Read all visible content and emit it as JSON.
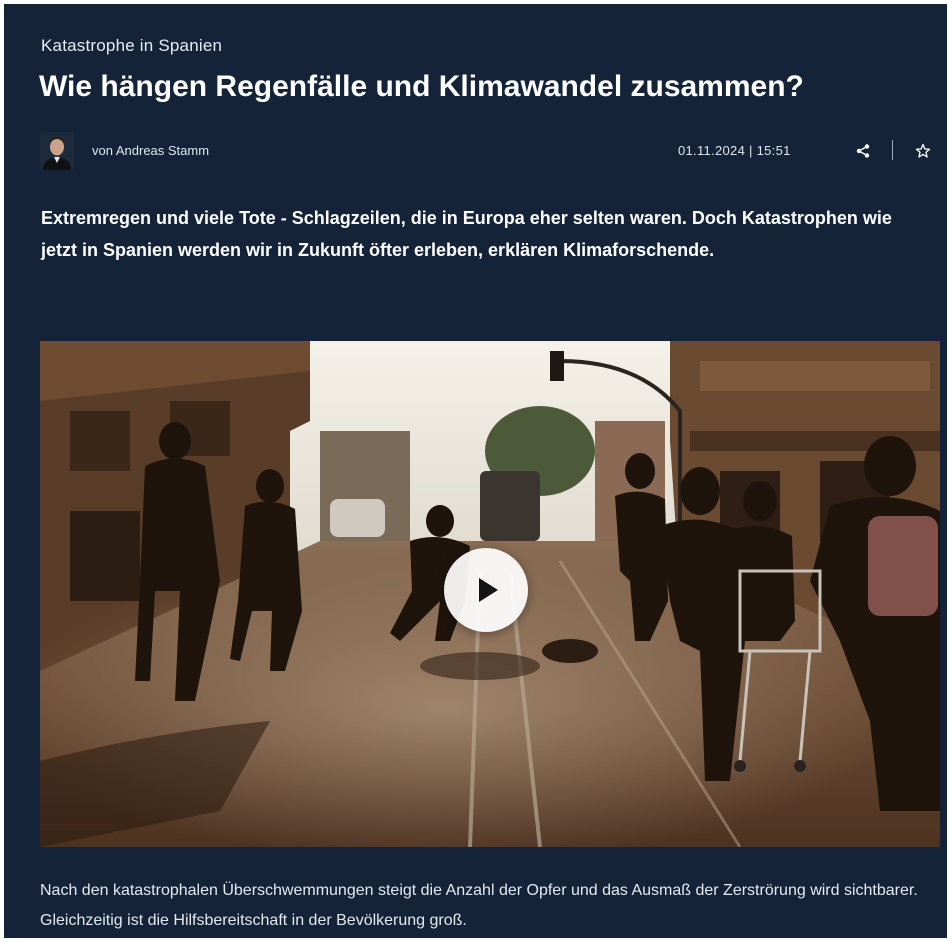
{
  "article": {
    "kicker": "Katastrophe in Spanien",
    "headline": "Wie hängen Regenfälle und Klimawandel zusammen?",
    "author": "von Andreas Stamm",
    "date": "01.11.2024 | 15:51",
    "teaser": "Extremregen und viele Tote - Schlagzeilen, die in Europa eher selten waren. Doch Katastrophen wie jetzt in Spanien werden wir in Zukunft öfter erleben, erklären Klimaforschende.",
    "caption": "Nach den katastrophalen Überschwemmungen steigt die Anzahl der Opfer und das Ausmaß der Zerströrung wird sichtbarer. Gleichzeitig ist die Hilfsbereitschaft in der Bevölkerung groß."
  },
  "icons": {
    "share": "share-icon",
    "bookmark": "star-icon",
    "play": "play-icon"
  },
  "colors": {
    "background": "#142338",
    "text": "#ffffff",
    "muted_text": "#dfe6ef"
  }
}
